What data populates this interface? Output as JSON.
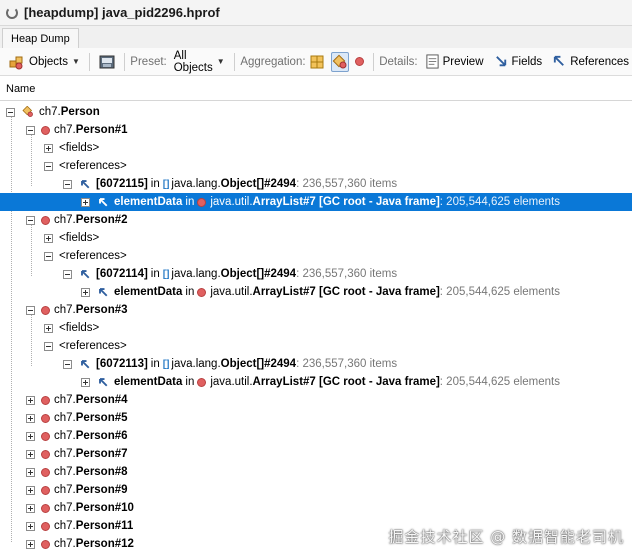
{
  "window": {
    "title": "[heapdump] java_pid2296.hprof"
  },
  "tabs": [
    {
      "label": "Heap Dump"
    }
  ],
  "toolbar": {
    "objects_label": "Objects",
    "preset_label": "Preset:",
    "preset_value": "All Objects",
    "aggregation_label": "Aggregation:",
    "details_label": "Details:",
    "preview_label": "Preview",
    "fields_label": "Fields",
    "references_label": "References"
  },
  "columns": [
    {
      "label": "Name"
    }
  ],
  "tree": {
    "root": {
      "pkg": "ch7.",
      "name": "Person"
    },
    "fields_label": "<fields>",
    "references_label": "<references>",
    "in_label": "in",
    "persons": [
      {
        "pkg": "ch7.",
        "name": "Person#1",
        "expanded": true,
        "ref": {
          "id": "[6072115]",
          "pkg": "java.lang.",
          "cls": "Object[]#2494",
          "detail": ": 236,557,360 items"
        },
        "element": {
          "name": "elementData",
          "pkg": "java.util.",
          "cls": "ArrayList#7 [GC root - Java frame]",
          "detail": ": 205,544,625 elements"
        }
      },
      {
        "pkg": "ch7.",
        "name": "Person#2",
        "expanded": true,
        "ref": {
          "id": "[6072114]",
          "pkg": "java.lang.",
          "cls": "Object[]#2494",
          "detail": ": 236,557,360 items"
        },
        "element": {
          "name": "elementData",
          "pkg": "java.util.",
          "cls": "ArrayList#7 [GC root - Java frame]",
          "detail": ": 205,544,625 elements"
        }
      },
      {
        "pkg": "ch7.",
        "name": "Person#3",
        "expanded": true,
        "ref": {
          "id": "[6072113]",
          "pkg": "java.lang.",
          "cls": "Object[]#2494",
          "detail": ": 236,557,360 items"
        },
        "element": {
          "name": "elementData",
          "pkg": "java.util.",
          "cls": "ArrayList#7 [GC root - Java frame]",
          "detail": ": 205,544,625 elements"
        }
      },
      {
        "pkg": "ch7.",
        "name": "Person#4"
      },
      {
        "pkg": "ch7.",
        "name": "Person#5"
      },
      {
        "pkg": "ch7.",
        "name": "Person#6"
      },
      {
        "pkg": "ch7.",
        "name": "Person#7"
      },
      {
        "pkg": "ch7.",
        "name": "Person#8"
      },
      {
        "pkg": "ch7.",
        "name": "Person#9"
      },
      {
        "pkg": "ch7.",
        "name": "Person#10"
      },
      {
        "pkg": "ch7.",
        "name": "Person#11"
      },
      {
        "pkg": "ch7.",
        "name": "Person#12"
      }
    ]
  },
  "watermark": "掘金技术社区 @ 数据智能老司机",
  "colors": {
    "selection": "#0a78d7",
    "instance_dot": "#e06060",
    "link": "#2f7fc8"
  }
}
